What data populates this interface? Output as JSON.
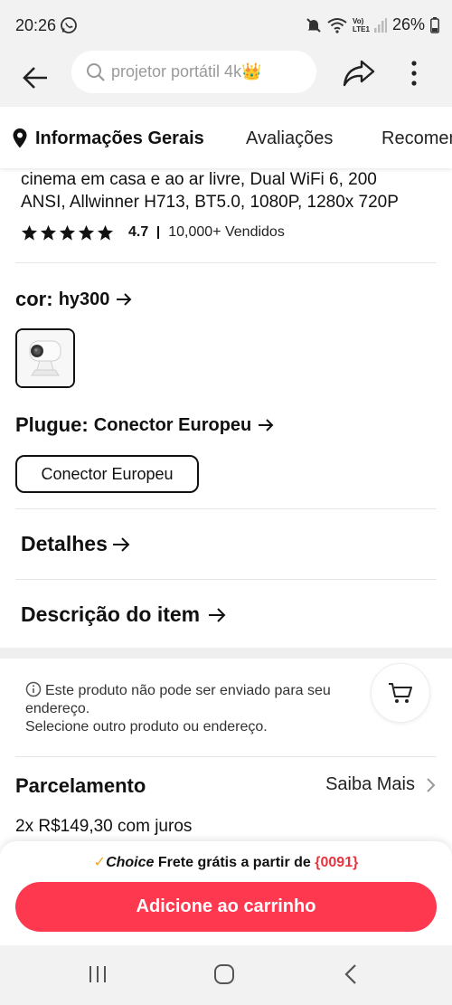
{
  "status_bar": {
    "time": "20:26",
    "lte_label": "Vo) LTE1",
    "battery": "26%"
  },
  "top_bar": {
    "search_placeholder": "projetor portátil 4k",
    "search_emoji": "👑"
  },
  "tabs": [
    {
      "label": "Informações Gerais",
      "active": true
    },
    {
      "label": "Avaliações",
      "active": false
    },
    {
      "label": "Recomen",
      "active": false
    }
  ],
  "product": {
    "title_line1": "cinema em casa e ao ar livre, Dual WiFi 6, 200",
    "title_line2": "ANSI, Allwinner H713, BT5.0, 1080P, 1280x 720P",
    "rating": "4.7",
    "stars": 5,
    "sold": "10,000+ Vendidos"
  },
  "color_option": {
    "label": "cor:",
    "value": "hy300"
  },
  "plug_option": {
    "label": "Plugue:",
    "value": "Conector Europeu",
    "chip": "Conector Europeu"
  },
  "links": {
    "details": "Detalhes",
    "description": "Descrição do item"
  },
  "shipping_note": {
    "line1": "Este produto não pode ser enviado para seu endereço.",
    "line2": "Selecione outro produto ou endereço."
  },
  "installments": {
    "title": "Parcelamento",
    "more": "Saiba Mais",
    "line": "2x R$149,30 com juros"
  },
  "bottom": {
    "choice_check": "✓",
    "choice_brand": "Choice",
    "free_shipping": "Frete grátis a partir de",
    "code": "{0091}",
    "add_to_cart": "Adicione ao carrinho"
  },
  "colors": {
    "accent": "#fd384f",
    "choice_check": "#f5a623",
    "code": "#e8343f"
  },
  "icons": [
    "whatsapp-icon",
    "mute-icon",
    "wifi-icon",
    "signal-icon",
    "battery-icon",
    "back-arrow-icon",
    "search-icon",
    "share-icon",
    "more-vert-icon",
    "location-pin-icon",
    "star-icon",
    "arrow-right-icon",
    "info-icon",
    "cart-icon",
    "chevron-right-icon",
    "nav-recent-icon",
    "nav-home-icon",
    "nav-back-icon"
  ]
}
